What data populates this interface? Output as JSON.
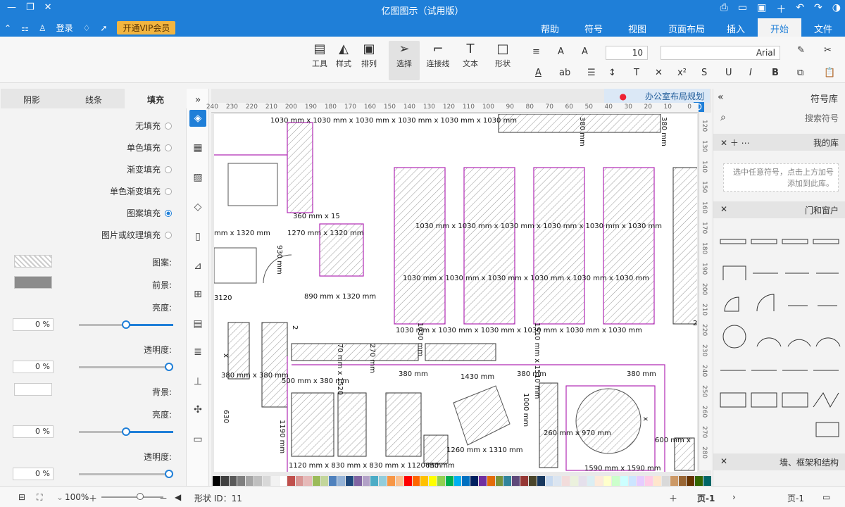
{
  "window": {
    "title": "亿图图示（试用版）"
  },
  "ribbon": {
    "tabs": [
      "文件",
      "开始",
      "插入",
      "页面布局",
      "视图",
      "符号",
      "帮助"
    ],
    "active_tab": "开始",
    "vip_label": "开通VIP会员",
    "login_label": "登录"
  },
  "toolbar": {
    "tools": [
      {
        "label": "选择"
      },
      {
        "label": "连接线"
      },
      {
        "label": "文本"
      },
      {
        "label": "形状"
      },
      {
        "label": "排列"
      },
      {
        "label": "样式"
      },
      {
        "label": "工具"
      }
    ],
    "font_family": "Arial",
    "font_size": "10"
  },
  "left_panel": {
    "tabs": [
      "填充",
      "线条",
      "阴影"
    ],
    "active_tab": "填充",
    "fill_options": [
      "无填充",
      "单色填充",
      "渐变填充",
      "单色渐变填充",
      "图案填充",
      "图片或纹理填充"
    ],
    "selected_fill": "图案填充",
    "labels": {
      "pattern": "图案:",
      "foreground": "前景:",
      "brightness": "亮度:",
      "transparency": "透明度:",
      "background": "背景:",
      "brightness2": "亮度:",
      "transparency2": "透明度:"
    },
    "values": {
      "brightness": "0 %",
      "transparency": "0 %",
      "brightness2": "0 %",
      "transparency2": "0 %"
    },
    "slider_levels": {
      "brightness": 0.5,
      "transparency": 0.0,
      "brightness2": 0.5,
      "transparency2": 0.0
    },
    "colors": {
      "foreground": "#8c8c8c",
      "background": "#ffffff"
    }
  },
  "canvas": {
    "doc_tab": "办公室布局规划",
    "h_ruler": [
      "0",
      "10",
      "20",
      "30",
      "40",
      "50",
      "60",
      "70",
      "80",
      "90",
      "100",
      "110",
      "120",
      "130",
      "140",
      "150",
      "160",
      "170",
      "180",
      "190",
      "200",
      "210",
      "220",
      "230",
      "240"
    ],
    "v_ruler": [
      "120",
      "130",
      "140",
      "150",
      "160",
      "170",
      "180",
      "190",
      "200",
      "210",
      "220",
      "230",
      "240",
      "250",
      "260",
      "270",
      "280"
    ],
    "dims": {
      "top1": "1030 mm x 1030 mm x 1030 mm x 1030 mm x 1030 mm x 1030 mm",
      "v380a": "380 mm",
      "v380b": "380 mm",
      "mid1": "1030 mm x 1030 mm x 1030 mm x 1030 mm x 1030 mm x 1030 mm",
      "mid2": "1030 mm x 1030 mm x 1030 mm x 1030 mm x 1030 mm x 1030 mm",
      "row3": "1030 mm x 1030 mm x 1030 mm x 1030 mm x 1030 mm x 1030 mm",
      "d360": "360 mm x 15",
      "d1270": "1270 mm x 1320 mm",
      "d1320": "mm x 1320 mm",
      "d890": "890 mm x 1320 mm",
      "d3120": "3120",
      "d380a": "380 mm",
      "d380b": "380 mm x 380 mm",
      "d500": "500 mm x 380 mm",
      "d1430": "1430 mm",
      "d380c": "380 mm",
      "d1260": "1260 mm x 1310 mm",
      "d260": "260 mm x 970 mm",
      "d1190": "1190 mm",
      "d1120": "1120 mm x 830 mm x 830 mm x 1120 mm",
      "d630": "630 mm",
      "d1590": "1590 mm x 1590 mm",
      "d600": "600 mm x",
      "d2": "2",
      "v1030": "1030 mm",
      "v1510": "1510 mm x 1510 mm",
      "v270": "270 mm",
      "v70": "70 mm x 1520",
      "v930": "930 mm",
      "v2": "2",
      "v1000": "1000 mm",
      "vx": "x",
      "vb": "x",
      "v630": "630",
      "v1190": "1190 mm",
      "v380d": "380 mm"
    }
  },
  "right_panel": {
    "title": "符号库",
    "search_placeholder": "搜索符号",
    "sections": {
      "favorites": "我的库",
      "doors": "门和窗户",
      "walls": "墙、框架和结构"
    },
    "hint": "选中任意符号，点击上方加号添加到此库。"
  },
  "status_bar": {
    "page_tab": "页-1",
    "page_tab2": "页-1",
    "shape_id": "形状 ID：11",
    "zoom": "100%"
  },
  "palette": [
    "#000000",
    "#3f3f3f",
    "#595959",
    "#7f7f7f",
    "#a5a5a5",
    "#bfbfbf",
    "#d8d8d8",
    "#f2f2f2",
    "#ffffff",
    "#c0504d",
    "#d99694",
    "#e6b9b8",
    "#9bbb59",
    "#c3d69b",
    "#4f81bd",
    "#95b3d7",
    "#1f497d",
    "#8064a2",
    "#b2a1c7",
    "#4bacc6",
    "#92cddc",
    "#f79646",
    "#fac08f",
    "#ff0000",
    "#ff6600",
    "#ffc000",
    "#ffff00",
    "#92d050",
    "#00b050",
    "#00b0f0",
    "#0070c0",
    "#002060",
    "#7030a0",
    "#e36c09",
    "#76923c",
    "#31849b",
    "#5f497a",
    "#953734",
    "#4a452a",
    "#17375e",
    "#c6d9f0",
    "#dbe5f1",
    "#f2dcdb",
    "#ebf1dd",
    "#e5e0ec",
    "#dbeef3",
    "#fdeada",
    "#ffffcc",
    "#ccffcc",
    "#ccffff",
    "#cce5ff",
    "#e6ccff",
    "#ffcce5",
    "#ffe6cc",
    "#d9d9d9",
    "#cc9966",
    "#996633",
    "#663300",
    "#336600",
    "#006666"
  ]
}
